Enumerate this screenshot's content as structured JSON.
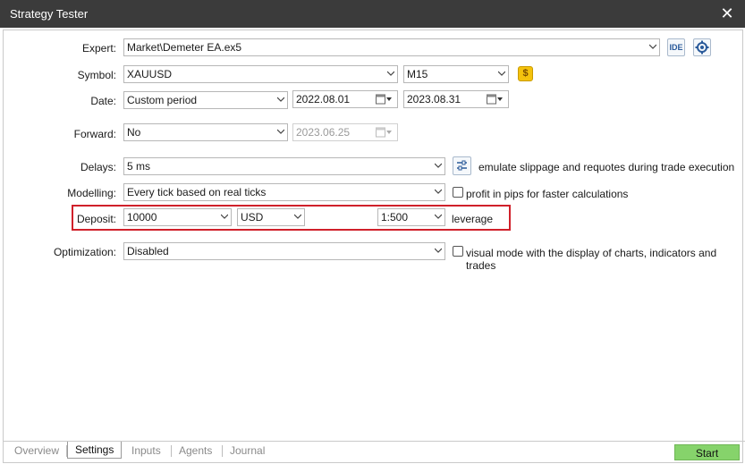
{
  "window": {
    "title": "Strategy Tester"
  },
  "labels": {
    "expert": "Expert:",
    "symbol": "Symbol:",
    "date": "Date:",
    "forward": "Forward:",
    "delays": "Delays:",
    "modelling": "Modelling:",
    "deposit": "Deposit:",
    "optimization": "Optimization:"
  },
  "fields": {
    "expert": "Market\\Demeter EA.ex5",
    "symbol": "XAUUSD",
    "timeframe": "M15",
    "date_mode": "Custom period",
    "date_from": "2022.08.01",
    "date_to": "2023.08.31",
    "forward": "No",
    "forward_date": "2023.06.25",
    "delays": "5 ms",
    "modelling": "Every tick based on real ticks",
    "deposit": "10000",
    "currency": "USD",
    "leverage": "1:500",
    "optimization": "Disabled"
  },
  "text": {
    "ide": "IDE",
    "leverage": "leverage",
    "emulate": "emulate slippage and requotes during trade execution",
    "profit_pips": "profit in pips for faster calculations",
    "visual_mode": "visual mode with the display of charts, indicators and trades"
  },
  "checkboxes": {
    "profit_pips": false,
    "visual_mode": false
  },
  "tabs": [
    {
      "label": "Overview",
      "active": false
    },
    {
      "label": "Settings",
      "active": true
    },
    {
      "label": "Inputs",
      "active": false
    },
    {
      "label": "Agents",
      "active": false
    },
    {
      "label": "Journal",
      "active": false
    }
  ],
  "buttons": {
    "start": "Start"
  },
  "colors": {
    "highlight": "#d0202a",
    "start_button": "#86d36b",
    "titlebar": "#3b3b3b"
  },
  "icons": [
    "close-icon",
    "gear-icon",
    "dollar-icon",
    "calendar-icon",
    "sliders-icon",
    "chevron-down-icon"
  ]
}
